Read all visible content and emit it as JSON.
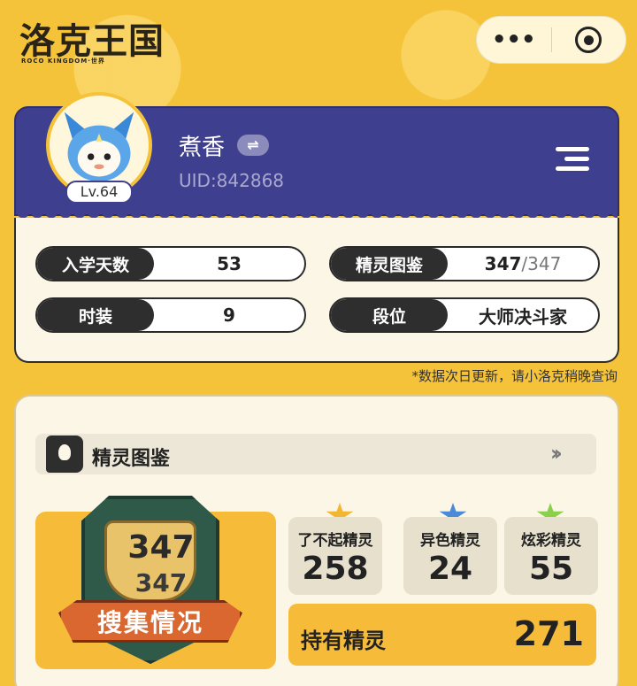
{
  "header": {
    "logo": "洛克王国",
    "logo_sub": "ROCO KINGDOM·世界",
    "more_icon": "ellipsis-icon",
    "close_icon": "target-icon"
  },
  "profile": {
    "username": "煮香",
    "swap_icon": "⇌",
    "uid": "UID:842868",
    "level": "Lv.64",
    "menu_icon": "menu-icon"
  },
  "stats": {
    "enroll_days_label": "入学天数",
    "enroll_days_value": "53",
    "costume_label": "时装",
    "costume_value": "9",
    "pokedex_label": "精灵图鉴",
    "pokedex_value": "347",
    "pokedex_total": "/347",
    "rank_label": "段位",
    "rank_value": "大师决斗家",
    "note": "*数据次日更新，请小洛克稍晚查询"
  },
  "collection": {
    "title": "精灵图鉴",
    "more_icon": "double-chevron-icon",
    "trophy_top": "347",
    "trophy_bottom": "347",
    "ribbon": "搜集情况",
    "categories": [
      {
        "label": "了不起精灵",
        "value": "258",
        "star_color": "#f2b632"
      },
      {
        "label": "异色精灵",
        "value": "24",
        "star_color": "#4a8ad8"
      },
      {
        "label": "炫彩精灵",
        "value": "55",
        "star_color": "#8ad04a"
      }
    ],
    "owned_label": "持有精灵",
    "owned_value": "271"
  }
}
